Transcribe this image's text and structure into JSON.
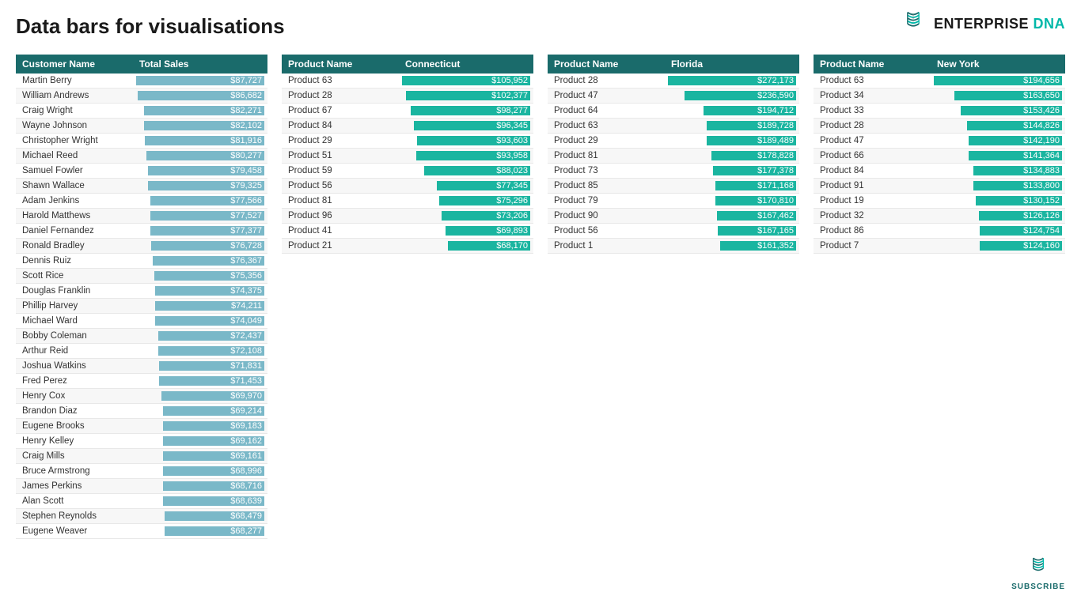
{
  "title": "Data bars for visualisations",
  "logo": {
    "text_part1": "ENTERPRISE ",
    "text_part2": "DNA",
    "subscribe_label": "SUBSCRIBE"
  },
  "table1": {
    "headers": [
      "Customer Name",
      "Total Sales"
    ],
    "rows": [
      {
        "name": "Martin Berry",
        "value": "$87,727",
        "pct": 100
      },
      {
        "name": "William Andrews",
        "value": "$86,682",
        "pct": 99
      },
      {
        "name": "Craig Wright",
        "value": "$82,271",
        "pct": 94
      },
      {
        "name": "Wayne Johnson",
        "value": "$82,102",
        "pct": 94
      },
      {
        "name": "Christopher Wright",
        "value": "$81,916",
        "pct": 93
      },
      {
        "name": "Michael Reed",
        "value": "$80,277",
        "pct": 92
      },
      {
        "name": "Samuel Fowler",
        "value": "$79,458",
        "pct": 91
      },
      {
        "name": "Shawn Wallace",
        "value": "$79,325",
        "pct": 91
      },
      {
        "name": "Adam Jenkins",
        "value": "$77,566",
        "pct": 89
      },
      {
        "name": "Harold Matthews",
        "value": "$77,527",
        "pct": 89
      },
      {
        "name": "Daniel Fernandez",
        "value": "$77,377",
        "pct": 89
      },
      {
        "name": "Ronald Bradley",
        "value": "$76,728",
        "pct": 88
      },
      {
        "name": "Dennis Ruiz",
        "value": "$76,367",
        "pct": 87
      },
      {
        "name": "Scott Rice",
        "value": "$75,356",
        "pct": 86
      },
      {
        "name": "Douglas Franklin",
        "value": "$74,375",
        "pct": 85
      },
      {
        "name": "Phillip Harvey",
        "value": "$74,211",
        "pct": 85
      },
      {
        "name": "Michael Ward",
        "value": "$74,049",
        "pct": 85
      },
      {
        "name": "Bobby Coleman",
        "value": "$72,437",
        "pct": 83
      },
      {
        "name": "Arthur Reid",
        "value": "$72,108",
        "pct": 83
      },
      {
        "name": "Joshua Watkins",
        "value": "$71,831",
        "pct": 82
      },
      {
        "name": "Fred Perez",
        "value": "$71,453",
        "pct": 82
      },
      {
        "name": "Henry Cox",
        "value": "$69,970",
        "pct": 80
      },
      {
        "name": "Brandon Diaz",
        "value": "$69,214",
        "pct": 79
      },
      {
        "name": "Eugene Brooks",
        "value": "$69,183",
        "pct": 79
      },
      {
        "name": "Henry Kelley",
        "value": "$69,162",
        "pct": 79
      },
      {
        "name": "Craig Mills",
        "value": "$69,161",
        "pct": 79
      },
      {
        "name": "Bruce Armstrong",
        "value": "$68,996",
        "pct": 79
      },
      {
        "name": "James Perkins",
        "value": "$68,716",
        "pct": 79
      },
      {
        "name": "Alan Scott",
        "value": "$68,639",
        "pct": 79
      },
      {
        "name": "Stephen Reynolds",
        "value": "$68,479",
        "pct": 78
      },
      {
        "name": "Eugene Weaver",
        "value": "$68,277",
        "pct": 78
      }
    ]
  },
  "table2": {
    "headers": [
      "Product Name",
      "Connecticut"
    ],
    "rows": [
      {
        "name": "Product 63",
        "value": "$105,952",
        "pct": 100
      },
      {
        "name": "Product 28",
        "value": "$102,377",
        "pct": 97
      },
      {
        "name": "Product 67",
        "value": "$98,277",
        "pct": 93
      },
      {
        "name": "Product 84",
        "value": "$96,345",
        "pct": 91
      },
      {
        "name": "Product 29",
        "value": "$93,603",
        "pct": 88
      },
      {
        "name": "Product 51",
        "value": "$93,958",
        "pct": 89
      },
      {
        "name": "Product 59",
        "value": "$88,023",
        "pct": 83
      },
      {
        "name": "Product 56",
        "value": "$77,345",
        "pct": 73
      },
      {
        "name": "Product 81",
        "value": "$75,296",
        "pct": 71
      },
      {
        "name": "Product 96",
        "value": "$73,206",
        "pct": 69
      },
      {
        "name": "Product 41",
        "value": "$69,893",
        "pct": 66
      },
      {
        "name": "Product 21",
        "value": "$68,170",
        "pct": 64
      }
    ]
  },
  "table3": {
    "headers": [
      "Product Name",
      "Florida"
    ],
    "rows": [
      {
        "name": "Product 28",
        "value": "$272,173",
        "pct": 100
      },
      {
        "name": "Product 47",
        "value": "$236,590",
        "pct": 87
      },
      {
        "name": "Product 64",
        "value": "$194,712",
        "pct": 72
      },
      {
        "name": "Product 63",
        "value": "$189,728",
        "pct": 70
      },
      {
        "name": "Product 29",
        "value": "$189,489",
        "pct": 70
      },
      {
        "name": "Product 81",
        "value": "$178,828",
        "pct": 66
      },
      {
        "name": "Product 73",
        "value": "$177,378",
        "pct": 65
      },
      {
        "name": "Product 85",
        "value": "$171,168",
        "pct": 63
      },
      {
        "name": "Product 79",
        "value": "$170,810",
        "pct": 63
      },
      {
        "name": "Product 90",
        "value": "$167,462",
        "pct": 62
      },
      {
        "name": "Product 56",
        "value": "$167,165",
        "pct": 61
      },
      {
        "name": "Product 1",
        "value": "$161,352",
        "pct": 59
      }
    ]
  },
  "table4": {
    "headers": [
      "Product Name",
      "New York"
    ],
    "rows": [
      {
        "name": "Product 63",
        "value": "$194,656",
        "pct": 100
      },
      {
        "name": "Product 34",
        "value": "$163,650",
        "pct": 84
      },
      {
        "name": "Product 33",
        "value": "$153,426",
        "pct": 79
      },
      {
        "name": "Product 28",
        "value": "$144,826",
        "pct": 74
      },
      {
        "name": "Product 47",
        "value": "$142,190",
        "pct": 73
      },
      {
        "name": "Product 66",
        "value": "$141,364",
        "pct": 73
      },
      {
        "name": "Product 84",
        "value": "$134,883",
        "pct": 69
      },
      {
        "name": "Product 91",
        "value": "$133,800",
        "pct": 69
      },
      {
        "name": "Product 19",
        "value": "$130,152",
        "pct": 67
      },
      {
        "name": "Product 32",
        "value": "$126,126",
        "pct": 65
      },
      {
        "name": "Product 86",
        "value": "$124,754",
        "pct": 64
      },
      {
        "name": "Product 7",
        "value": "$124,160",
        "pct": 64
      }
    ]
  }
}
